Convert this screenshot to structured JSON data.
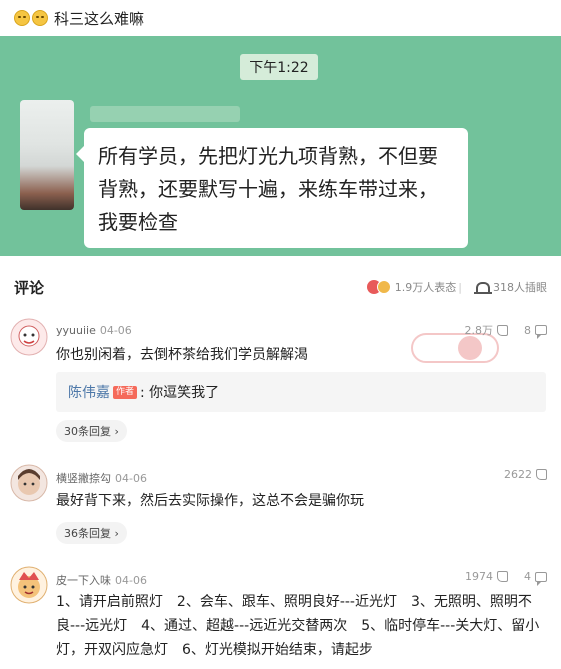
{
  "header": {
    "title": "科三这么难嘛"
  },
  "chat": {
    "time": "下午1:22",
    "message": "所有学员，先把灯光九项背熟，不但要背熟，还要默写十遍，来练车带过来，我要检查"
  },
  "comments_section": {
    "label": "评论",
    "reactions": "1.9万人表态",
    "collected": "318人插眼"
  },
  "comments": [
    {
      "user": "yyuuiie",
      "date": "04-06",
      "likes": "2.8万",
      "replies_count": "8",
      "text": "你也别闲着，去倒杯茶给我们学员解解渴",
      "reply": {
        "name": "陈伟嘉",
        "tag": "作者",
        "text": ": 你逗笑我了"
      },
      "more": "30条回复 ›"
    },
    {
      "user": "横竖撇捺勾",
      "date": "04-06",
      "likes": "2622",
      "text": "最好背下来，然后去实际操作，这总不会是骗你玩",
      "more": "36条回复 ›"
    },
    {
      "user": "皮一下入味",
      "date": "04-06",
      "likes": "1974",
      "replies_count": "4",
      "text": "1、请开启前照灯　2、会车、跟车、照明良好---近光灯　3、无照明、照明不良---远光灯　4、通过、超越---远近光交替两次　5、临时停车---关大灯、留小灯，开双闪应急灯　6、灯光模拟开始结束，请起步"
    }
  ],
  "colors": {
    "chat_bg": "#72c29b",
    "link_blue": "#4c77a8",
    "author_tag": "#f56a5a"
  }
}
